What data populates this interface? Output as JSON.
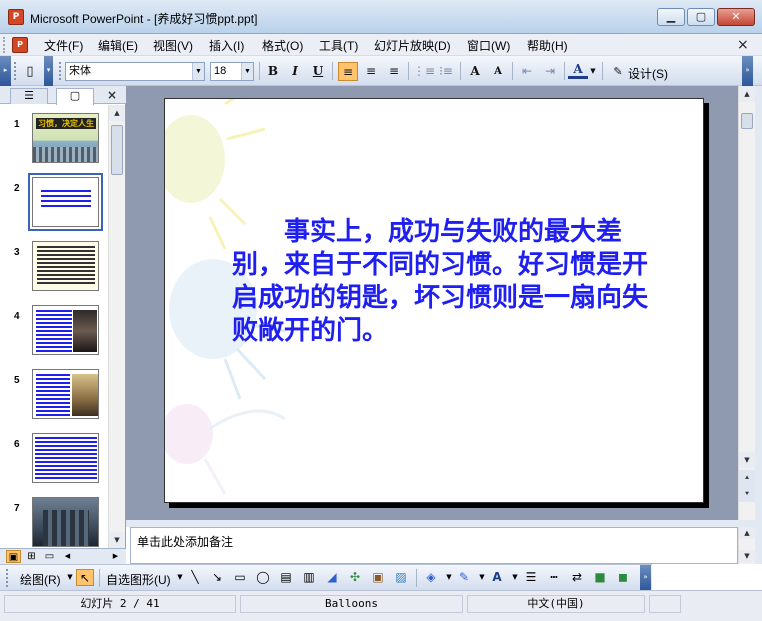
{
  "window": {
    "icon_label": "P",
    "title": "Microsoft PowerPoint - [养成好习惯ppt.ppt]",
    "min_label": "▁",
    "max_label": "▢",
    "close_label": "✕"
  },
  "menu": {
    "items": [
      "文件(F)",
      "编辑(E)",
      "视图(V)",
      "插入(I)",
      "格式(O)",
      "工具(T)",
      "幻灯片放映(D)",
      "窗口(W)",
      "帮助(H)"
    ],
    "close_label": "×"
  },
  "toolbar": {
    "font_name": "宋体",
    "font_size": "18",
    "bold": "B",
    "italic": "I",
    "underline": "U",
    "grow_font": "A",
    "shrink_font": "A",
    "font_color": "A",
    "design_label": "设计(S)"
  },
  "slides_pane": {
    "tab_outline": "☰",
    "tab_slides": "▢",
    "close_label": "×",
    "slide_numbers": [
      "1",
      "2",
      "3",
      "4",
      "5",
      "6",
      "7"
    ],
    "thumb1_title": "习惯，决定人生"
  },
  "slide": {
    "text": "事实上，成功与失败的最大差别，来自于不同的习惯。好习惯是开启成功的钥匙，坏习惯则是一扇向失败敞开的门。"
  },
  "notes": {
    "placeholder": "单击此处添加备注"
  },
  "drawing": {
    "draw_label": "绘图(R)",
    "autoshapes_label": "自选图形(U)"
  },
  "status": {
    "slide_pos": "幻灯片 2 / 41",
    "design": "Balloons",
    "language": "中文(中国)"
  },
  "colors": {
    "slide_text": "#1f1ff0",
    "title_bar": "#b9d1ea",
    "editor_bg": "#8f9ab1"
  }
}
